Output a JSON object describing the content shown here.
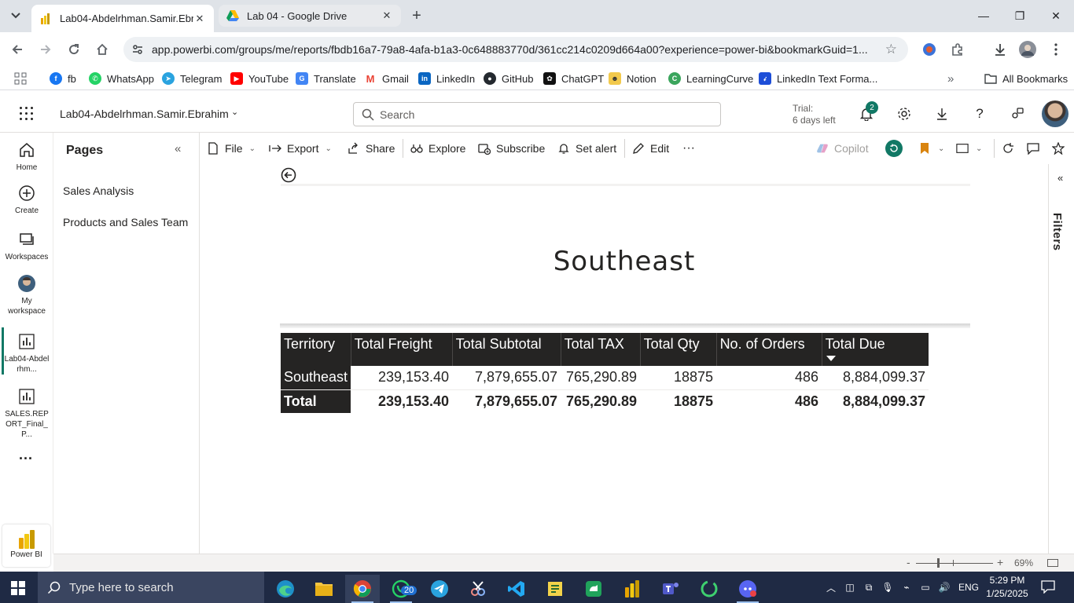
{
  "browser": {
    "tabs": [
      {
        "title": "Lab04-Abdelrhman.Samir.Ebrahim",
        "active": true,
        "favicon": "powerbi-icon"
      },
      {
        "title": "Lab 04 - Google Drive",
        "active": false,
        "favicon": "google-drive-icon"
      }
    ],
    "url": "app.powerbi.com/groups/me/reports/fbdb16a7-79a8-4afa-b1a3-0c648883770d/361cc214c0209d664a00?experience=power-bi&bookmarkGuid=1...",
    "bookmarks": [
      {
        "label": "fb",
        "color": "#1877f2"
      },
      {
        "label": "WhatsApp",
        "color": "#25d366"
      },
      {
        "label": "Telegram",
        "color": "#2aa3df"
      },
      {
        "label": "YouTube",
        "color": "#ff0000"
      },
      {
        "label": "Translate",
        "color": "#4285f4"
      },
      {
        "label": "Gmail",
        "color": "#ea4335"
      },
      {
        "label": "LinkedIn",
        "color": "#0a66c2"
      },
      {
        "label": "GitHub",
        "color": "#24292f"
      },
      {
        "label": "ChatGPT",
        "color": "#111111"
      },
      {
        "label": "Notion",
        "color": "#f2c94c"
      },
      {
        "label": "LearningCurve",
        "color": "#3ba55d"
      },
      {
        "label": "LinkedIn Text Forma...",
        "color": "#1d4ed8"
      }
    ],
    "all_bookmarks_label": "All Bookmarks"
  },
  "pbi": {
    "report_name": "Lab04-Abdelrhman.Samir.Ebrahim",
    "search_placeholder": "Search",
    "trial_line1": "Trial:",
    "trial_line2": "6 days left",
    "notification_count": "2",
    "accent_color": "#117865",
    "rail": [
      {
        "label": "Home"
      },
      {
        "label": "Create"
      },
      {
        "label": "Workspaces"
      },
      {
        "label": "My workspace"
      },
      {
        "label": "Lab04-Abdelrhm..."
      },
      {
        "label": "SALES.REPORT_Final_P..."
      }
    ],
    "rail_more": "...",
    "powerbi_label": "Power BI",
    "pages_title": "Pages",
    "pages": [
      "Sales Analysis",
      "Products and Sales Team"
    ],
    "actions": {
      "file": "File",
      "export": "Export",
      "share": "Share",
      "explore": "Explore",
      "subscribe": "Subscribe",
      "set_alert": "Set alert",
      "edit": "Edit",
      "more": "···",
      "copilot": "Copilot"
    },
    "filters_label": "Filters",
    "zoom_minus": "-",
    "zoom_plus": "+",
    "zoom": "69%"
  },
  "report": {
    "title": "Southeast",
    "table": {
      "columns": [
        "Territory",
        "Total Freight",
        "Total Subtotal",
        "Total TAX",
        "Total Qty",
        "No. of Orders",
        "Total Due"
      ],
      "sorted_column": "Total Due",
      "rows": [
        [
          "Southeast",
          "239,153.40",
          "7,879,655.07",
          "765,290.89",
          "18875",
          "486",
          "8,884,099.37"
        ]
      ],
      "total": [
        "Total",
        "239,153.40",
        "7,879,655.07",
        "765,290.89",
        "18875",
        "486",
        "8,884,099.37"
      ]
    }
  },
  "taskbar": {
    "search_placeholder": "Type here to search",
    "whatsapp_badge": "20",
    "language": "ENG",
    "time": "5:29 PM",
    "date": "1/25/2025"
  }
}
